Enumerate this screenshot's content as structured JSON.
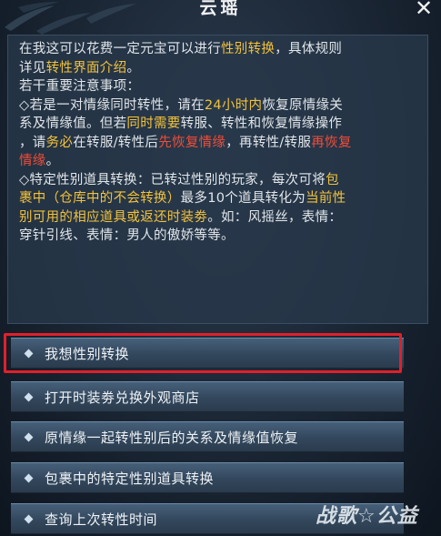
{
  "header": {
    "title": "云瑶",
    "close_label": "✕"
  },
  "intro": {
    "line1": [
      {
        "t": "在我这可以花费一定元宝可以进行",
        "c": ""
      },
      {
        "t": "性别转换",
        "c": "y"
      },
      {
        "t": "，具体规则",
        "c": ""
      }
    ],
    "line2": [
      {
        "t": "详见",
        "c": ""
      },
      {
        "t": "转性界面介绍",
        "c": "y"
      },
      {
        "t": "。",
        "c": ""
      }
    ],
    "line3": [
      {
        "t": "若干重要注意事项：",
        "c": ""
      }
    ],
    "line4": [
      {
        "t": "◇若是一对情缘同时转性，请在",
        "c": ""
      },
      {
        "t": "24小时内",
        "c": "y"
      },
      {
        "t": "恢复原情缘关",
        "c": ""
      }
    ],
    "line5": [
      {
        "t": "系及情缘值。但若",
        "c": ""
      },
      {
        "t": "同时需要",
        "c": "y"
      },
      {
        "t": "转服、转性和恢复情缘操作",
        "c": ""
      }
    ],
    "line6": [
      {
        "t": "，请",
        "c": ""
      },
      {
        "t": "务必",
        "c": "y"
      },
      {
        "t": "在转服/转性后",
        "c": ""
      },
      {
        "t": "先恢复情缘",
        "c": "r"
      },
      {
        "t": "，再转性/转服",
        "c": ""
      },
      {
        "t": "再恢复",
        "c": "r"
      }
    ],
    "line7": [
      {
        "t": "情缘",
        "c": "r"
      },
      {
        "t": "。",
        "c": ""
      }
    ],
    "line8": [
      {
        "t": "◇特定性别道具转换：已转过性别的玩家，每次可将",
        "c": ""
      },
      {
        "t": "包",
        "c": "y"
      }
    ],
    "line9": [
      {
        "t": "裹中（仓库中的不会转换）",
        "c": "y"
      },
      {
        "t": "最多10个道具转化为",
        "c": ""
      },
      {
        "t": "当前性",
        "c": "y"
      }
    ],
    "line10": [
      {
        "t": "别可用的相应道具或返还时装劵",
        "c": "y"
      },
      {
        "t": "。如：风摇丝，表情：",
        "c": ""
      }
    ],
    "line11": [
      {
        "t": "穿针引线、表情：男人的傲娇等等。",
        "c": ""
      }
    ]
  },
  "options": [
    {
      "label": "我想性别转换"
    },
    {
      "label": "打开时装劵兑换外观商店"
    },
    {
      "label": "原情缘一起转性别后的关系及情缘值恢复"
    },
    {
      "label": "包裹中的特定性别道具转换"
    },
    {
      "label": "查询上次转性时间"
    }
  ],
  "watermark": {
    "text": "战歌☆公益"
  },
  "colors": {
    "highlight": "#f3c23c",
    "warning": "#f04c38",
    "selection_box": "#e0202a"
  }
}
